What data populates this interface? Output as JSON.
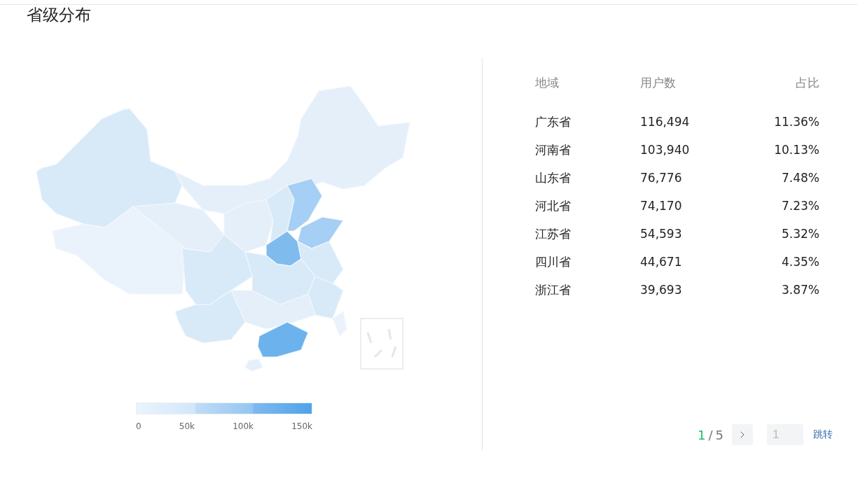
{
  "title": "省级分布",
  "legend": {
    "ticks": [
      "0",
      "50k",
      "100k",
      "150k"
    ]
  },
  "table": {
    "columns": [
      "地域",
      "用户数",
      "占比"
    ],
    "rows": [
      {
        "region": "广东省",
        "users": "116,494",
        "share": "11.36%"
      },
      {
        "region": "河南省",
        "users": "103,940",
        "share": "10.13%"
      },
      {
        "region": "山东省",
        "users": "76,776",
        "share": "7.48%"
      },
      {
        "region": "河北省",
        "users": "74,170",
        "share": "7.23%"
      },
      {
        "region": "江苏省",
        "users": "54,593",
        "share": "5.32%"
      },
      {
        "region": "四川省",
        "users": "44,671",
        "share": "4.35%"
      },
      {
        "region": "浙江省",
        "users": "39,693",
        "share": "3.87%"
      }
    ]
  },
  "pagination": {
    "current": "1",
    "separator": "/",
    "total": "5",
    "jump_placeholder": "1",
    "jump_button": "跳转"
  }
}
